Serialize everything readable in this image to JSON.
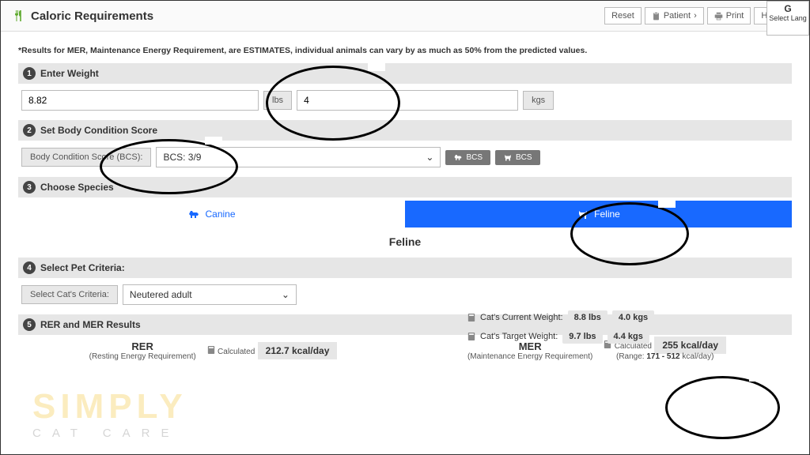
{
  "header": {
    "title": "Caloric Requirements"
  },
  "toolbar": {
    "reset": "Reset",
    "patient": "Patient",
    "print": "Print",
    "help": "Help"
  },
  "lang": {
    "letter": "G",
    "label": "Select Lang"
  },
  "disclaimer": "*Results for MER, Maintenance Energy Requirement, are ESTIMATES, individual animals can vary by as much as 50% from the predicted values.",
  "steps": {
    "s1": {
      "num": "1",
      "title": "Enter Weight",
      "lbs_val": "8.82",
      "lbs_unit": "lbs",
      "kgs_val": "4",
      "kgs_unit": "kgs"
    },
    "s2": {
      "num": "2",
      "title": "Set Body Condition Score",
      "bcs_label": "Body Condition Score (BCS):",
      "bcs_val": "BCS: 3/9",
      "btn": "BCS"
    },
    "s3": {
      "num": "3",
      "title": "Choose Species",
      "canine": "Canine",
      "feline": "Feline",
      "selected": "Feline"
    },
    "s4": {
      "num": "4",
      "title": "Select Pet Criteria:",
      "crit_label": "Select Cat's Criteria:",
      "crit_val": "Neutered adult"
    },
    "s5": {
      "num": "5",
      "title": "RER and MER Results"
    }
  },
  "weights": {
    "current_label": "Cat's Current Weight:",
    "current_lbs": "8.8 lbs",
    "current_kgs": "4.0 kgs",
    "target_label": "Cat's Target Weight:",
    "target_lbs": "9.7 lbs",
    "target_kgs": "4.4 kgs"
  },
  "results": {
    "rer_title": "RER",
    "rer_sub": "(Resting Energy Requirement)",
    "rer_calc": "Calculated",
    "rer_val": "212.7 kcal/day",
    "mer_title": "MER",
    "mer_sub": "(Maintenance Energy Requirement)",
    "mer_calc": "Calculated",
    "mer_val": "255 kcal/day",
    "mer_range_prefix": "(Range: ",
    "mer_range_bold": "171 - 512",
    "mer_range_suffix": " kcal/day)"
  },
  "watermark": {
    "top": "SIMPLY",
    "bottom": "CAT CARE"
  }
}
